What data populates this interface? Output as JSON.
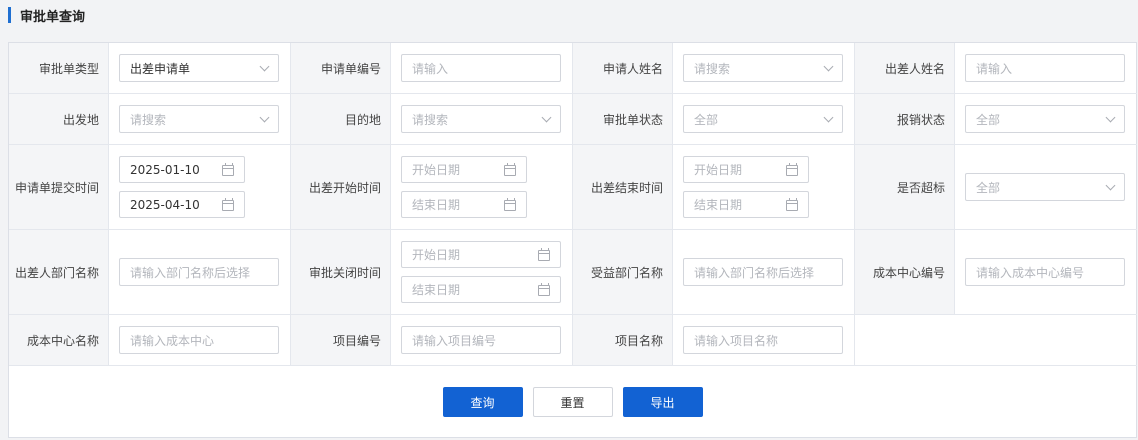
{
  "page": {
    "title": "审批单查询"
  },
  "form": {
    "approval_type": {
      "label": "审批单类型",
      "value": "出差申请单"
    },
    "application_no": {
      "label": "申请单编号",
      "placeholder": "请输入"
    },
    "applicant_name": {
      "label": "申请人姓名",
      "placeholder": "请搜索"
    },
    "traveler_name": {
      "label": "出差人姓名",
      "placeholder": "请输入"
    },
    "departure": {
      "label": "出发地",
      "placeholder": "请搜索"
    },
    "destination": {
      "label": "目的地",
      "placeholder": "请搜索"
    },
    "approval_status": {
      "label": "审批单状态",
      "value": "全部"
    },
    "reimbursement_status": {
      "label": "报销状态",
      "value": "全部"
    },
    "submit_time": {
      "label": "申请单提交时间",
      "start": "2025-01-10",
      "end": "2025-04-10"
    },
    "trip_start_time": {
      "label": "出差开始时间",
      "start_placeholder": "开始日期",
      "end_placeholder": "结束日期"
    },
    "trip_end_time": {
      "label": "出差结束时间",
      "start_placeholder": "开始日期",
      "end_placeholder": "结束日期"
    },
    "over_standard": {
      "label": "是否超标",
      "value": "全部"
    },
    "traveler_dept": {
      "label": "出差人部门名称",
      "placeholder": "请输入部门名称后选择"
    },
    "close_time": {
      "label": "审批关闭时间",
      "start_placeholder": "开始日期",
      "end_placeholder": "结束日期"
    },
    "benefit_dept": {
      "label": "受益部门名称",
      "placeholder": "请输入部门名称后选择"
    },
    "cost_center_no": {
      "label": "成本中心编号",
      "placeholder": "请输入成本中心编号"
    },
    "cost_center_name": {
      "label": "成本中心名称",
      "placeholder": "请输入成本中心"
    },
    "project_no": {
      "label": "项目编号",
      "placeholder": "请输入项目编号"
    },
    "project_name": {
      "label": "项目名称",
      "placeholder": "请输入项目名称"
    }
  },
  "actions": {
    "search": "查询",
    "reset": "重置",
    "export": "导出"
  },
  "colors": {
    "primary": "#1262d3",
    "accent_bar": "#1f6fd1"
  },
  "icons": {
    "dropdown": "chevron-down-icon",
    "date": "calendar-icon"
  }
}
